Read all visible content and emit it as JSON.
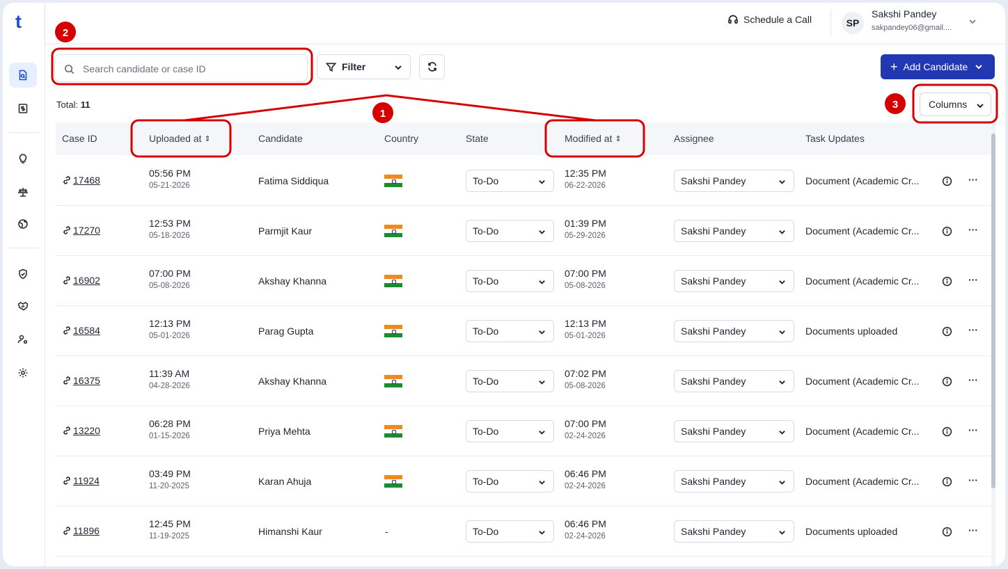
{
  "app": {
    "logo": "t"
  },
  "sidebar": {
    "items": [
      {
        "icon": "document-search-icon",
        "active": true
      },
      {
        "icon": "dollar-doc-icon",
        "active": false
      },
      {
        "icon": "lightbulb-icon",
        "active": false
      },
      {
        "icon": "scale-icon",
        "active": false
      },
      {
        "icon": "globe-icon",
        "active": false
      },
      {
        "icon": "shield-check-icon",
        "active": false
      },
      {
        "icon": "handshake-icon",
        "active": false
      },
      {
        "icon": "user-settings-icon",
        "active": false
      },
      {
        "icon": "gear-icon",
        "active": false
      }
    ]
  },
  "header": {
    "schedule_label": "Schedule a Call",
    "user_initials": "SP",
    "user_name": "Sakshi Pandey",
    "user_email": "sakpandey06@gmail...."
  },
  "toolbar": {
    "search_placeholder": "Search candidate or case ID",
    "filter_label": "Filter",
    "add_label": "Add Candidate",
    "total_label": "Total:",
    "total_value": "11",
    "columns_label": "Columns"
  },
  "table": {
    "headers": {
      "case_id": "Case ID",
      "uploaded_at": "Uploaded at",
      "candidate": "Candidate",
      "country": "Country",
      "state": "State",
      "modified_at": "Modified at",
      "assignee": "Assignee",
      "task_updates": "Task Updates"
    },
    "rows": [
      {
        "case_id": "17468",
        "up_time": "05:56 PM",
        "up_date": "05-21-2026",
        "candidate": "Fatima Siddiqua",
        "country": "india-flag",
        "state": "To-Do",
        "mod_time": "12:35 PM",
        "mod_date": "06-22-2026",
        "assignee": "Sakshi Pandey",
        "task": "Document (Academic Cr..."
      },
      {
        "case_id": "17270",
        "up_time": "12:53 PM",
        "up_date": "05-18-2026",
        "candidate": "Parmjit Kaur",
        "country": "india-flag",
        "state": "To-Do",
        "mod_time": "01:39 PM",
        "mod_date": "05-29-2026",
        "assignee": "Sakshi Pandey",
        "task": "Document (Academic Cr..."
      },
      {
        "case_id": "16902",
        "up_time": "07:00 PM",
        "up_date": "05-08-2026",
        "candidate": "Akshay Khanna",
        "country": "india-flag",
        "state": "To-Do",
        "mod_time": "07:00 PM",
        "mod_date": "05-08-2026",
        "assignee": "Sakshi Pandey",
        "task": "Document (Academic Cr..."
      },
      {
        "case_id": "16584",
        "up_time": "12:13 PM",
        "up_date": "05-01-2026",
        "candidate": "Parag Gupta",
        "country": "india-flag",
        "state": "To-Do",
        "mod_time": "12:13 PM",
        "mod_date": "05-01-2026",
        "assignee": "Sakshi Pandey",
        "task": "Documents uploaded"
      },
      {
        "case_id": "16375",
        "up_time": "11:39 AM",
        "up_date": "04-28-2026",
        "candidate": "Akshay Khanna",
        "country": "india-flag",
        "state": "To-Do",
        "mod_time": "07:02 PM",
        "mod_date": "05-08-2026",
        "assignee": "Sakshi Pandey",
        "task": "Document (Academic Cr..."
      },
      {
        "case_id": "13220",
        "up_time": "06:28 PM",
        "up_date": "01-15-2026",
        "candidate": "Priya Mehta",
        "country": "india-flag",
        "state": "To-Do",
        "mod_time": "07:00 PM",
        "mod_date": "02-24-2026",
        "assignee": "Sakshi Pandey",
        "task": "Document (Academic Cr..."
      },
      {
        "case_id": "11924",
        "up_time": "03:49 PM",
        "up_date": "11-20-2025",
        "candidate": "Karan Ahuja",
        "country": "india-flag",
        "state": "To-Do",
        "mod_time": "06:46 PM",
        "mod_date": "02-24-2026",
        "assignee": "Sakshi Pandey",
        "task": "Document (Academic Cr..."
      },
      {
        "case_id": "11896",
        "up_time": "12:45 PM",
        "up_date": "11-19-2025",
        "candidate": "Himanshi Kaur",
        "country": "-",
        "state": "To-Do",
        "mod_time": "06:46 PM",
        "mod_date": "02-24-2026",
        "assignee": "Sakshi Pandey",
        "task": "Documents uploaded"
      }
    ]
  },
  "annotations": {
    "badge_1": "1",
    "badge_2": "2",
    "badge_3": "3",
    "color": "#d50000"
  },
  "colors": {
    "primary": "#2238b3",
    "brand": "#1b4fd8"
  }
}
